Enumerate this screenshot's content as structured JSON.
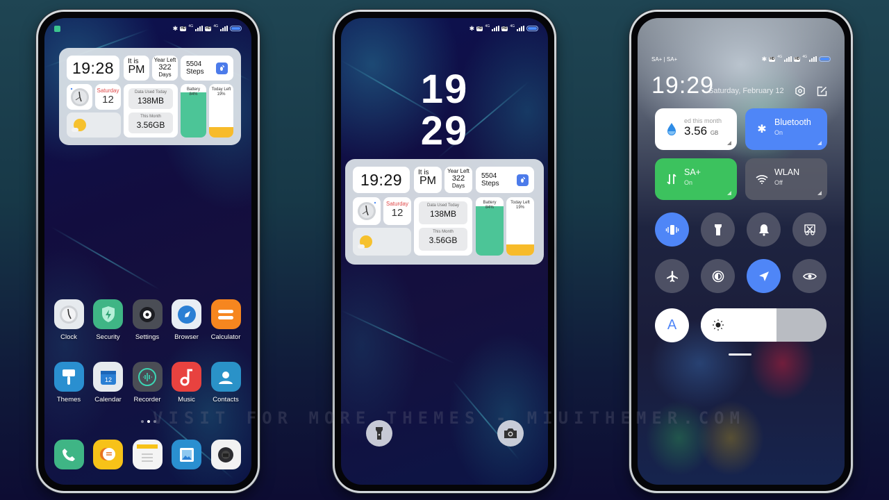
{
  "watermark": "VISIT FOR MORE THEMES - MIUITHEMER.COM",
  "status_bar": {
    "network_label": "4G",
    "hd_label": "HD",
    "carrier_label": "SA+ | SA+"
  },
  "widget_home": {
    "time": "19:28",
    "ampm_prefix": "It is",
    "ampm": "PM",
    "year_left_label": "Year Left",
    "year_left_value": "322",
    "year_left_unit": "Days",
    "steps_value": "5504",
    "steps_label": "Steps",
    "weekday": "Saturday",
    "day": "12",
    "data_today_label": "Data Used Today",
    "data_today_value": "138MB",
    "data_month_label": "This Month",
    "data_month_value": "3.56GB",
    "battery_label": "Battery",
    "battery_value": "84%",
    "battery_level": 0.84,
    "today_left_label": "Today Left",
    "today_left_value": "19%",
    "today_left_level": 0.19
  },
  "widget_lock": {
    "time": "19:29",
    "ampm_prefix": "It is",
    "ampm": "PM",
    "year_left_label": "Year Left",
    "year_left_value": "322",
    "year_left_unit": "Days",
    "steps_value": "5504",
    "steps_label": "Steps",
    "weekday": "Saturday",
    "day": "12",
    "data_today_label": "Data Used Today",
    "data_today_value": "138MB",
    "data_month_label": "This Month",
    "data_month_value": "3.56GB",
    "battery_label": "Battery",
    "battery_value": "84%",
    "battery_level": 0.84,
    "today_left_label": "Today Left",
    "today_left_value": "19%",
    "today_left_level": 0.19
  },
  "home_apps": {
    "row1": [
      {
        "label": "Clock",
        "icon": "clock-icon",
        "bg": "#e6eaee"
      },
      {
        "label": "Security",
        "icon": "shield-icon",
        "bg": "#3fb585"
      },
      {
        "label": "Settings",
        "icon": "gear-icon",
        "bg": "#4a4d55"
      },
      {
        "label": "Browser",
        "icon": "compass-icon",
        "bg": "#e8eef4"
      },
      {
        "label": "Calculator",
        "icon": "equals-icon",
        "bg": "#f6861f"
      }
    ],
    "row2": [
      {
        "label": "Themes",
        "icon": "brush-icon",
        "bg": "#2a8fd0"
      },
      {
        "label": "Calendar",
        "icon": "calendar-icon",
        "bg": "#e6eaee",
        "badge": "12"
      },
      {
        "label": "Recorder",
        "icon": "waveform-icon",
        "bg": "#4a4d55"
      },
      {
        "label": "Music",
        "icon": "music-note-icon",
        "bg": "#e8423f"
      },
      {
        "label": "Contacts",
        "icon": "person-icon",
        "bg": "#2a92c8"
      }
    ],
    "dock": [
      {
        "name": "phone",
        "icon": "phone-icon",
        "bg": "#3fb585"
      },
      {
        "name": "messages",
        "icon": "chat-bubble-icon",
        "bg": "#f7c218"
      },
      {
        "name": "notes",
        "icon": "notes-icon",
        "bg": "#f4f4f4"
      },
      {
        "name": "gallery",
        "icon": "image-icon",
        "bg": "#2a8fd0"
      },
      {
        "name": "camera",
        "icon": "camera-icon",
        "bg": "#f2f2f2"
      }
    ],
    "page_count": 3,
    "current_page": 2
  },
  "lock_screen": {
    "hour": "19",
    "minute": "29"
  },
  "control_center": {
    "time": "19:29",
    "date": "Saturday, February 12",
    "tiles": [
      {
        "title": "3.56",
        "unit": "GB",
        "subtitle": "ed this month",
        "icon": "water-drop-icon"
      },
      {
        "title": "Bluetooth",
        "subtitle": "On",
        "icon": "bluetooth-icon"
      },
      {
        "title": "SA+",
        "subtitle": "On",
        "icon": "mobile-data-icon"
      },
      {
        "title": "WLAN",
        "subtitle": "Off",
        "icon": "wifi-icon"
      }
    ],
    "toggles": [
      {
        "name": "vibrate",
        "on": true
      },
      {
        "name": "flashlight",
        "on": false
      },
      {
        "name": "sound",
        "on": false
      },
      {
        "name": "screenshot",
        "on": false
      },
      {
        "name": "airplane-mode",
        "on": false
      },
      {
        "name": "dark-mode",
        "on": false
      },
      {
        "name": "location",
        "on": true
      },
      {
        "name": "reading-mode",
        "on": false
      }
    ],
    "auto_brightness_label": "A",
    "brightness_level": 0.6
  }
}
